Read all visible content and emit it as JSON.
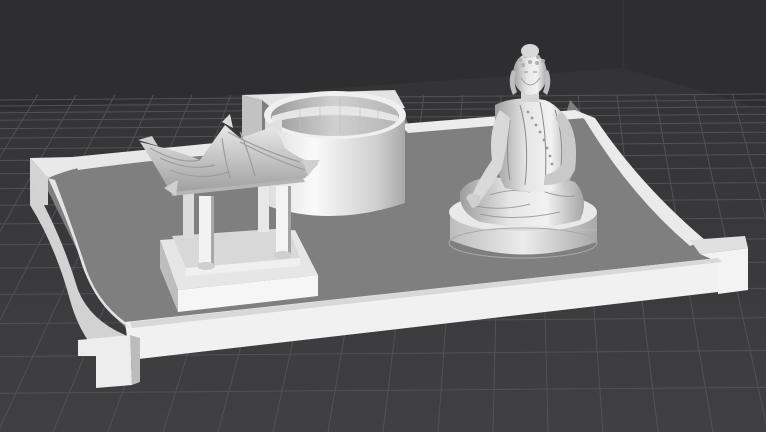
{
  "viewport": {
    "background_color": "#2e2e30",
    "floor_color": "#3a3a3c",
    "grid_line_color": "#525254",
    "grid_major_color": "#5e5e60",
    "back_wall_color": "#333335"
  },
  "model": {
    "tray_top_color": "#7f7f80",
    "tray_rim_light": "#f2f2f2",
    "tray_rim_mid": "#d9d9d9",
    "tray_rim_dark": "#b3b3b3",
    "body_light": "#f4f4f4",
    "body_mid": "#cfcfcf",
    "body_dark": "#9a9a9a",
    "objects": [
      {
        "name": "tray",
        "icon": "tray-base-shape"
      },
      {
        "name": "pavilion",
        "icon": "pagoda-shape"
      },
      {
        "name": "cylinder-cup",
        "icon": "cylinder-shape"
      },
      {
        "name": "buddha-statue",
        "icon": "statue-shape"
      }
    ]
  }
}
